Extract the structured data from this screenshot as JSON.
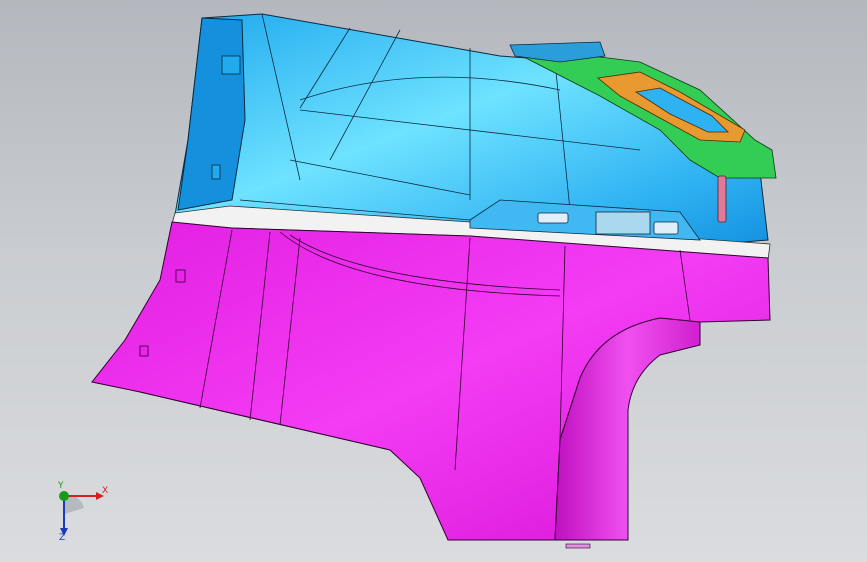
{
  "viewport": {
    "background_top": "#b4b8be",
    "background_bottom": "#dadcdf"
  },
  "model": {
    "parts": [
      {
        "name": "upper-panel",
        "color": "#22aaee"
      },
      {
        "name": "lower-panel",
        "color": "#ee22ee"
      },
      {
        "name": "inner-bracket",
        "color": "#33cc55"
      },
      {
        "name": "inner-frame",
        "color": "#e89a30"
      },
      {
        "name": "belt-strip",
        "color": "#f2f2f2"
      }
    ]
  },
  "triad": {
    "x_label": "X",
    "y_label": "Y",
    "z_label": "Z",
    "x_color": "#d32020",
    "y_color": "#1a9a1a",
    "z_color": "#1a3ab8"
  }
}
